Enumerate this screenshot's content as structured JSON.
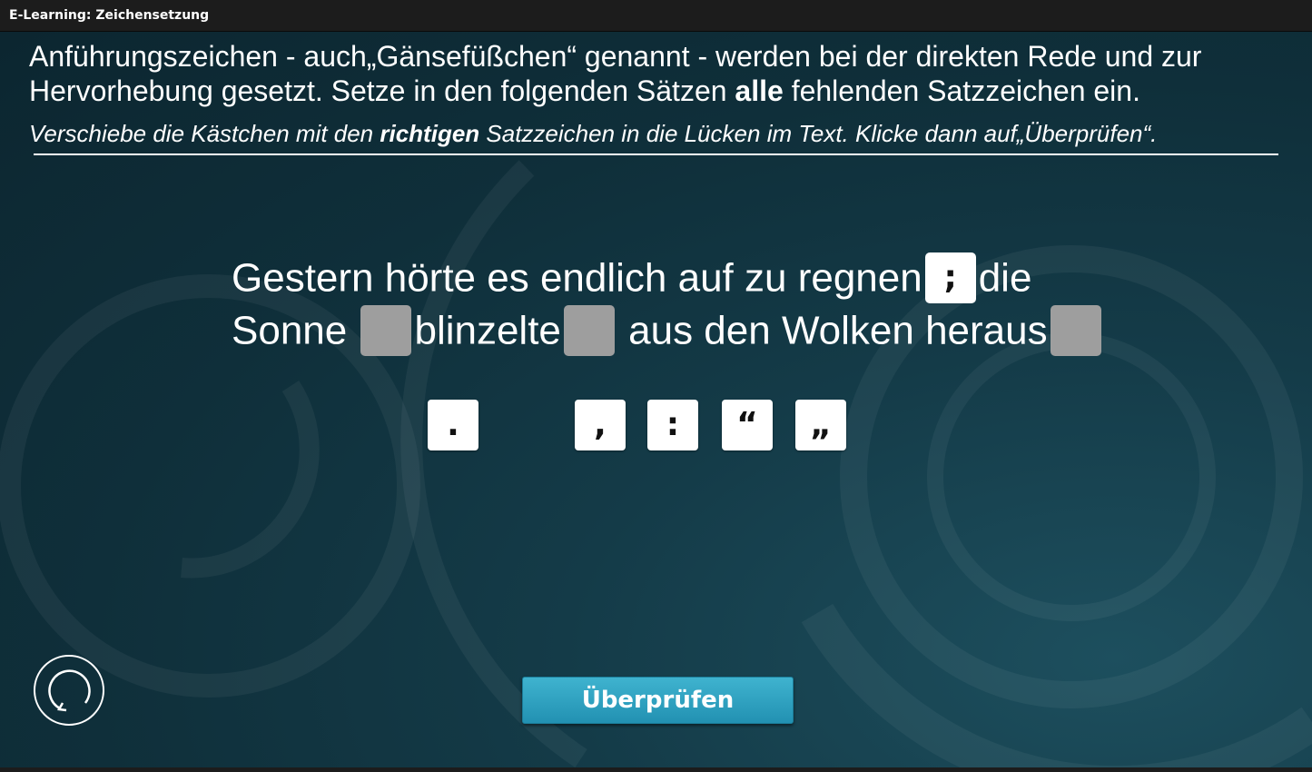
{
  "window": {
    "title": "E-Learning: Zeichensetzung"
  },
  "intro": {
    "part1": "Anführungszeichen - auch„Gänsefüßchen“ genannt - werden bei der direkten Rede und zur Hervorhebung gesetzt. Setze in den folgenden Sätzen ",
    "bold": "alle",
    "part2": " fehlenden Satzzeichen ein."
  },
  "instruction": {
    "part1": "Verschiebe die Kästchen mit den ",
    "bold": "richtigen",
    "part2": " Satzzeichen in die Lücken im Text. Klicke dann auf„Überprüfen“."
  },
  "sentence": {
    "line1_a": "Gestern hörte es endlich auf zu regnen",
    "slot1_value": ";",
    "line1_b": "die",
    "line2_a": "Sonne",
    "line2_b": "blinzelte",
    "line2_c": "aus den Wolken heraus"
  },
  "tiles": [
    ".",
    ",",
    ":",
    "“",
    "„"
  ],
  "buttons": {
    "check": "Überprüfen"
  },
  "colors": {
    "background": "#143b48",
    "button": "#2ea2c2",
    "slot_empty": "#9e9e9e",
    "tile": "#ffffff"
  },
  "icons": {
    "reset": "reset-icon"
  }
}
